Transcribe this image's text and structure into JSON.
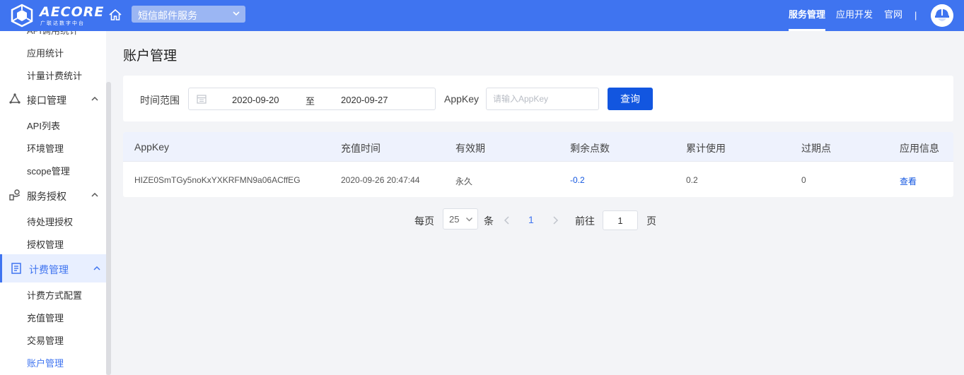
{
  "header": {
    "logo_text": "AECORE",
    "logo_sub": "广联达数字中台",
    "service_selected": "短信邮件服务",
    "nav": [
      "服务管理",
      "应用开发",
      "官网"
    ],
    "nav_separator": "|"
  },
  "sidebar": {
    "top_partial": "API调用统计",
    "stats": [
      "应用统计",
      "计量计费统计"
    ],
    "groups": [
      {
        "label": "接口管理",
        "items": [
          "API列表",
          "环境管理",
          "scope管理"
        ]
      },
      {
        "label": "服务授权",
        "items": [
          "待处理授权",
          "授权管理"
        ]
      },
      {
        "label": "计费管理",
        "items": [
          "计费方式配置",
          "充值管理",
          "交易管理",
          "账户管理"
        ]
      }
    ]
  },
  "main": {
    "title": "账户管理",
    "filter": {
      "time_label": "时间范围",
      "start_date": "2020-09-20",
      "range_separator": "至",
      "end_date": "2020-09-27",
      "appkey_label": "AppKey",
      "appkey_placeholder": "请输入AppKey",
      "query_label": "查询"
    },
    "table": {
      "columns": [
        "AppKey",
        "充值时间",
        "有效期",
        "剩余点数",
        "累计使用",
        "过期点",
        "应用信息"
      ],
      "rows": [
        [
          "HIZE0SmTGy5noKxYXKRFMN9a06ACffEG",
          "2020-09-26 20:47:44",
          "永久",
          "-0.2",
          "0.2",
          "0",
          "查看"
        ]
      ]
    },
    "pagination": {
      "per_page_label": "每页",
      "page_size": "25",
      "unit_label": "条",
      "current_page": "1",
      "goto_label": "前往",
      "goto_value": "1",
      "page_label": "页"
    }
  },
  "colors": {
    "primary": "#3f74f0",
    "button": "#1256e0",
    "background": "#f3f4f7"
  }
}
